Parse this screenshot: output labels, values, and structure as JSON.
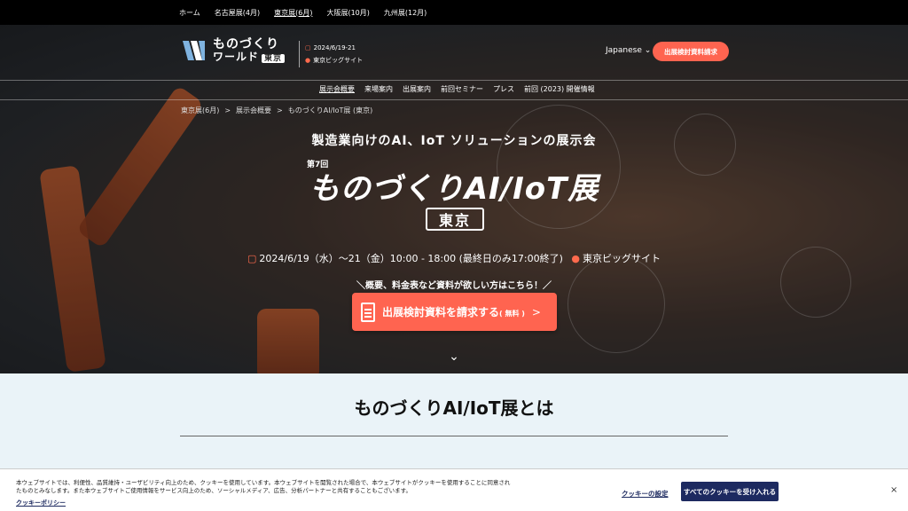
{
  "topbar": {
    "items": [
      {
        "label": "ホーム"
      },
      {
        "label": "名古屋展(4月)"
      },
      {
        "label": "東京展(6月)"
      },
      {
        "label": "大阪展(10月)"
      },
      {
        "label": "九州展(12月)"
      }
    ]
  },
  "header": {
    "logo_line1": "ものづくり",
    "logo_line2": "ワールド",
    "logo_badge": "東京",
    "date": "2024/6/19-21",
    "venue": "東京ビッグサイト",
    "language": "Japanese",
    "cta_label": "出展検討資料請求"
  },
  "nav": {
    "items": [
      {
        "label": "展示会概要"
      },
      {
        "label": "来場案内"
      },
      {
        "label": "出展案内"
      },
      {
        "label": "前回セミナー"
      },
      {
        "label": "プレス"
      },
      {
        "label": "前回 (2023) 開催情報"
      }
    ]
  },
  "breadcrumb": {
    "items": [
      "東京展(6月)",
      "展示会概要",
      "ものづくりAI/IoT展 (東京)"
    ],
    "sep": ">"
  },
  "hero": {
    "subtitle": "製造業向けのAI、IoT ソリューションの展示会",
    "edition": "第7回",
    "title": "ものづくりAI/IoT展",
    "city": "東京",
    "dateline_date": "2024/6/19（水）～21（金）10:00 - 18:00 (最終日のみ17:00終了)",
    "dateline_venue": "東京ビッグサイト",
    "prompt": "＼概要、料金表など資料が欲しい方はこちら！／",
    "cta_main": "出展検討資料を請求する",
    "cta_small": "( 無料 )",
    "cta_arrow": ">"
  },
  "about": {
    "title": "ものづくりAI/IoT展とは"
  },
  "cookie": {
    "text": "本ウェブサイトでは、利便性、品質維持・ユーザビリティ向上のため、クッキーを使用しています。本ウェブサイトを閲覧された場合で、本ウェブサイトがクッキーを使用することに同意されたものとみなします。また本ウェブサイトご使用情報をサービス向上のため、ソーシャルメディア、広告、分析パートナーと共有することもございます。",
    "policy_link": "クッキーポリシー",
    "settings": "クッキーの設定",
    "accept": "すべてのクッキーを受け入れる",
    "close": "×"
  }
}
